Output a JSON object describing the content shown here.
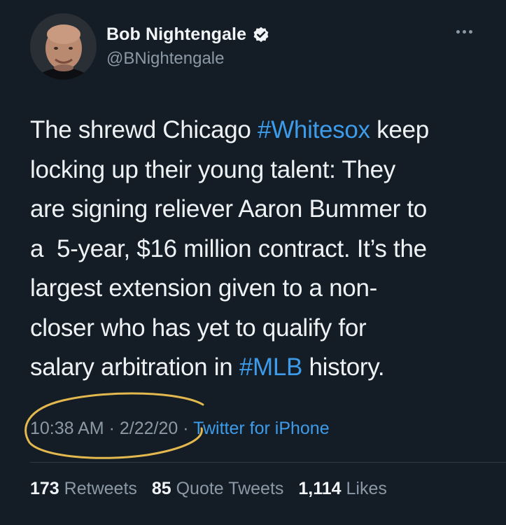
{
  "author": {
    "display_name": "Bob Nightengale",
    "handle": "@BNightengale",
    "verified": true,
    "avatar_icon": "profile-photo"
  },
  "tweet": {
    "lines": [
      [
        "The shrewd Chicago ",
        "#Whitesox",
        " keep"
      ],
      [
        "locking up their young talent: They"
      ],
      [
        "are signing reliever Aaron Bummer to"
      ],
      [
        "a  5-year, $16 million contract. It’s the"
      ],
      [
        "largest extension given to a non-"
      ],
      [
        "closer who has yet to qualify for"
      ],
      [
        "salary arbitration in ",
        "#MLB",
        " history."
      ]
    ],
    "hashtags": [
      "#Whitesox",
      "#MLB"
    ],
    "time": "10:38 AM",
    "date": "2/22/20",
    "source": "Twitter for iPhone",
    "separator": "·"
  },
  "stats": {
    "retweets_count": "173",
    "retweets_label": "Retweets",
    "quote_count": "85",
    "quote_label": "Quote Tweets",
    "likes_count": "1,114",
    "likes_label": "Likes"
  },
  "colors": {
    "background": "#141d26",
    "link": "#3d9be9",
    "secondary_text": "#8b98a5",
    "annotation": "#e3b94f"
  }
}
